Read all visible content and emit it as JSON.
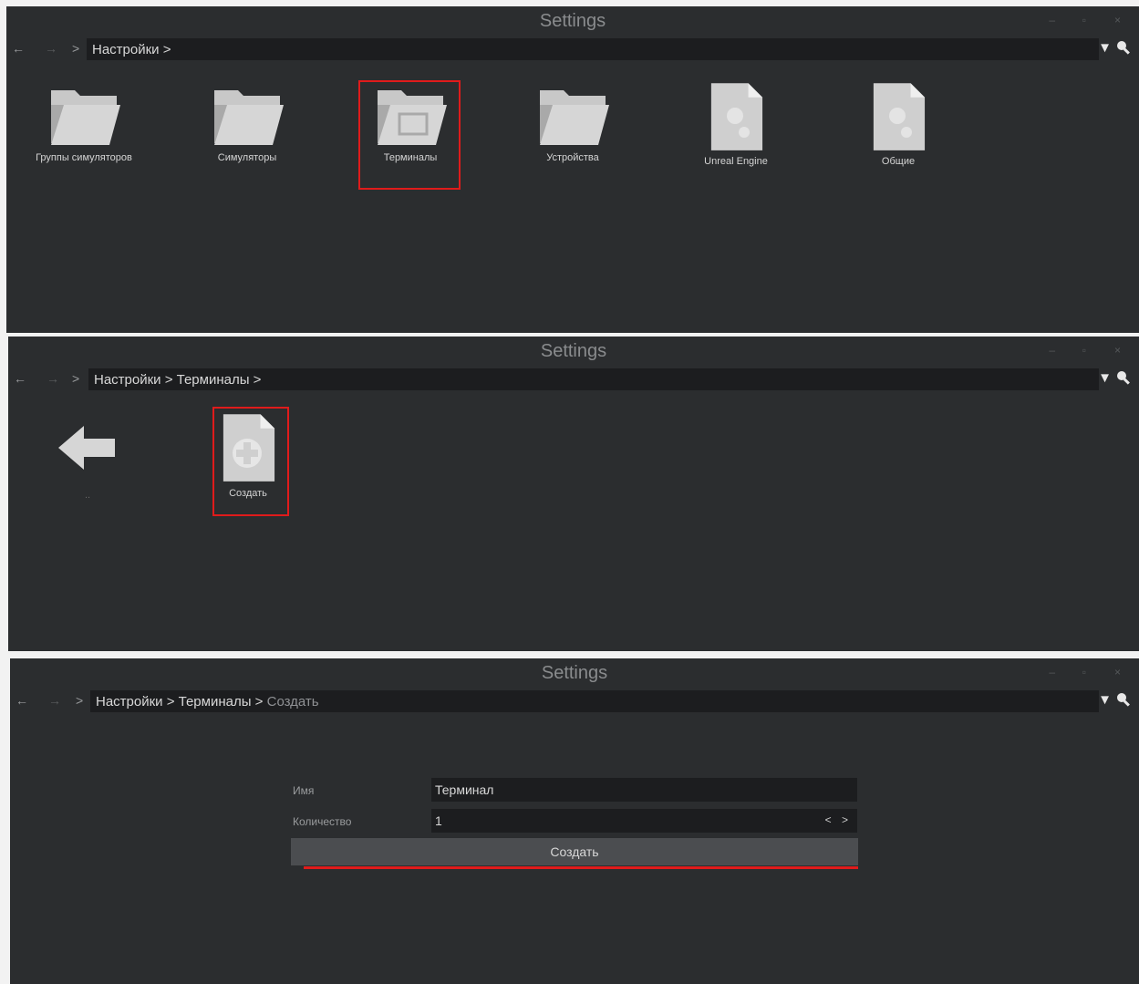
{
  "window_title": "Settings",
  "win_controls": {
    "minimize": "–",
    "maximize": "▫",
    "close": "×"
  },
  "nav": {
    "back": "←",
    "forward": "→",
    "up": ">"
  },
  "filter_icon": "▼",
  "panel1": {
    "breadcrumb": "Настройки >",
    "tiles": [
      {
        "label": "Группы симуляторов",
        "icon": "folder-icon"
      },
      {
        "label": "Симуляторы",
        "icon": "folder-icon"
      },
      {
        "label": "Терминалы",
        "icon": "folder-icon",
        "highlighted": true
      },
      {
        "label": "Устройства",
        "icon": "folder-icon"
      },
      {
        "label": "Unreal Engine",
        "icon": "settings-document-icon"
      },
      {
        "label": "Общие",
        "icon": "settings-document-icon"
      }
    ]
  },
  "panel2": {
    "breadcrumb": "Настройки > Терминалы >",
    "back_tile_label": "..",
    "create_tile_label": "Создать"
  },
  "panel3": {
    "breadcrumb_path": "Настройки > Терминалы > ",
    "breadcrumb_current": "Создать",
    "form": {
      "name_label": "Имя",
      "name_value": "Терминал",
      "count_label": "Количество",
      "count_value": "1",
      "stepper": "< >",
      "submit_label": "Создать"
    }
  },
  "colors": {
    "window_bg": "#2b2d2f",
    "field_bg": "#1c1d1f",
    "highlight": "#e01b1b",
    "button_bg": "#4b4d50"
  }
}
